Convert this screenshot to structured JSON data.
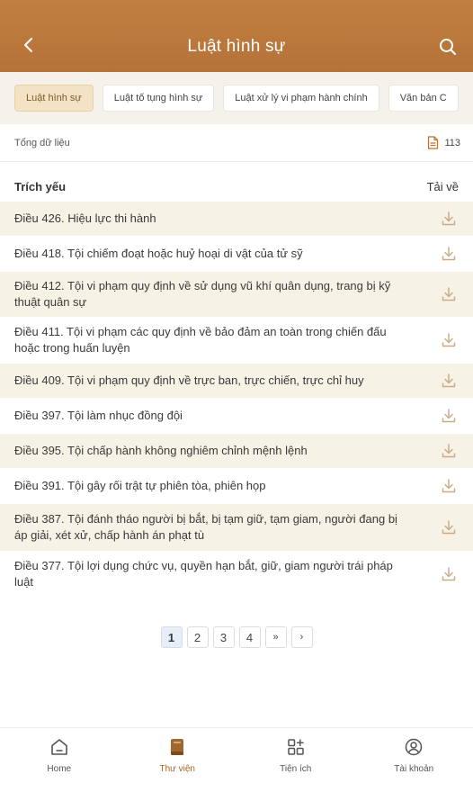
{
  "header": {
    "title": "Luật hình sự",
    "back_icon": "chevron-left-icon",
    "search_icon": "search-icon"
  },
  "tabs": [
    {
      "label": "Luật hình sự",
      "active": true
    },
    {
      "label": "Luật tố tụng hình sự",
      "active": false
    },
    {
      "label": "Luật xử lý vi phạm hành chính",
      "active": false
    },
    {
      "label": "Văn bản C",
      "active": false
    }
  ],
  "summary": {
    "label": "Tổng dữ liệu",
    "count": "113",
    "icon": "document-icon"
  },
  "list": {
    "col_title": "Trích yếu",
    "col_download": "Tải về",
    "items": [
      {
        "text": "Điều 426. Hiệu lực thi hành"
      },
      {
        "text": "Điều 418. Tội chiếm đoạt hoặc huỷ hoại di vật của tử sỹ"
      },
      {
        "text": "Điều 412. Tội vi phạm quy định về sử dụng vũ khí quân dụng, trang bị kỹ thuật quân sự"
      },
      {
        "text": "Điều 411. Tội vi phạm các quy định về bảo đảm an toàn trong chiến đấu hoặc trong huấn luyện"
      },
      {
        "text": "Điều 409. Tội vi phạm quy định về trực ban, trực chiến, trực chỉ huy"
      },
      {
        "text": "Điều 397. Tội làm nhục đồng đội"
      },
      {
        "text": "Điều 395. Tội chấp hành không nghiêm chỉnh mệnh lệnh"
      },
      {
        "text": "Điều 391. Tội gây rối trật tự phiên tòa, phiên họp"
      },
      {
        "text": "Điều 387. Tội đánh tháo người bị bắt, bị tạm giữ, tạm giam, người đang bị áp giải, xét xử, chấp hành án phạt tù"
      },
      {
        "text": "Điều 377. Tội lợi dụng chức vụ, quyền hạn bắt, giữ, giam người trái pháp luật"
      }
    ]
  },
  "pagination": {
    "pages": [
      "1",
      "2",
      "3",
      "4"
    ],
    "current": "1",
    "last_label": "»",
    "next_label": "›"
  },
  "bottom_nav": [
    {
      "label": "Home",
      "icon": "home-icon",
      "active": false
    },
    {
      "label": "Thư viện",
      "icon": "book-icon",
      "active": true
    },
    {
      "label": "Tiện ích",
      "icon": "apps-icon",
      "active": false
    },
    {
      "label": "Tài khoản",
      "icon": "account-icon",
      "active": false
    }
  ],
  "colors": {
    "header": "#b5723a",
    "accent": "#a0672e",
    "row_alt": "#f7f2e6",
    "icon_muted": "#c9ad8a"
  }
}
